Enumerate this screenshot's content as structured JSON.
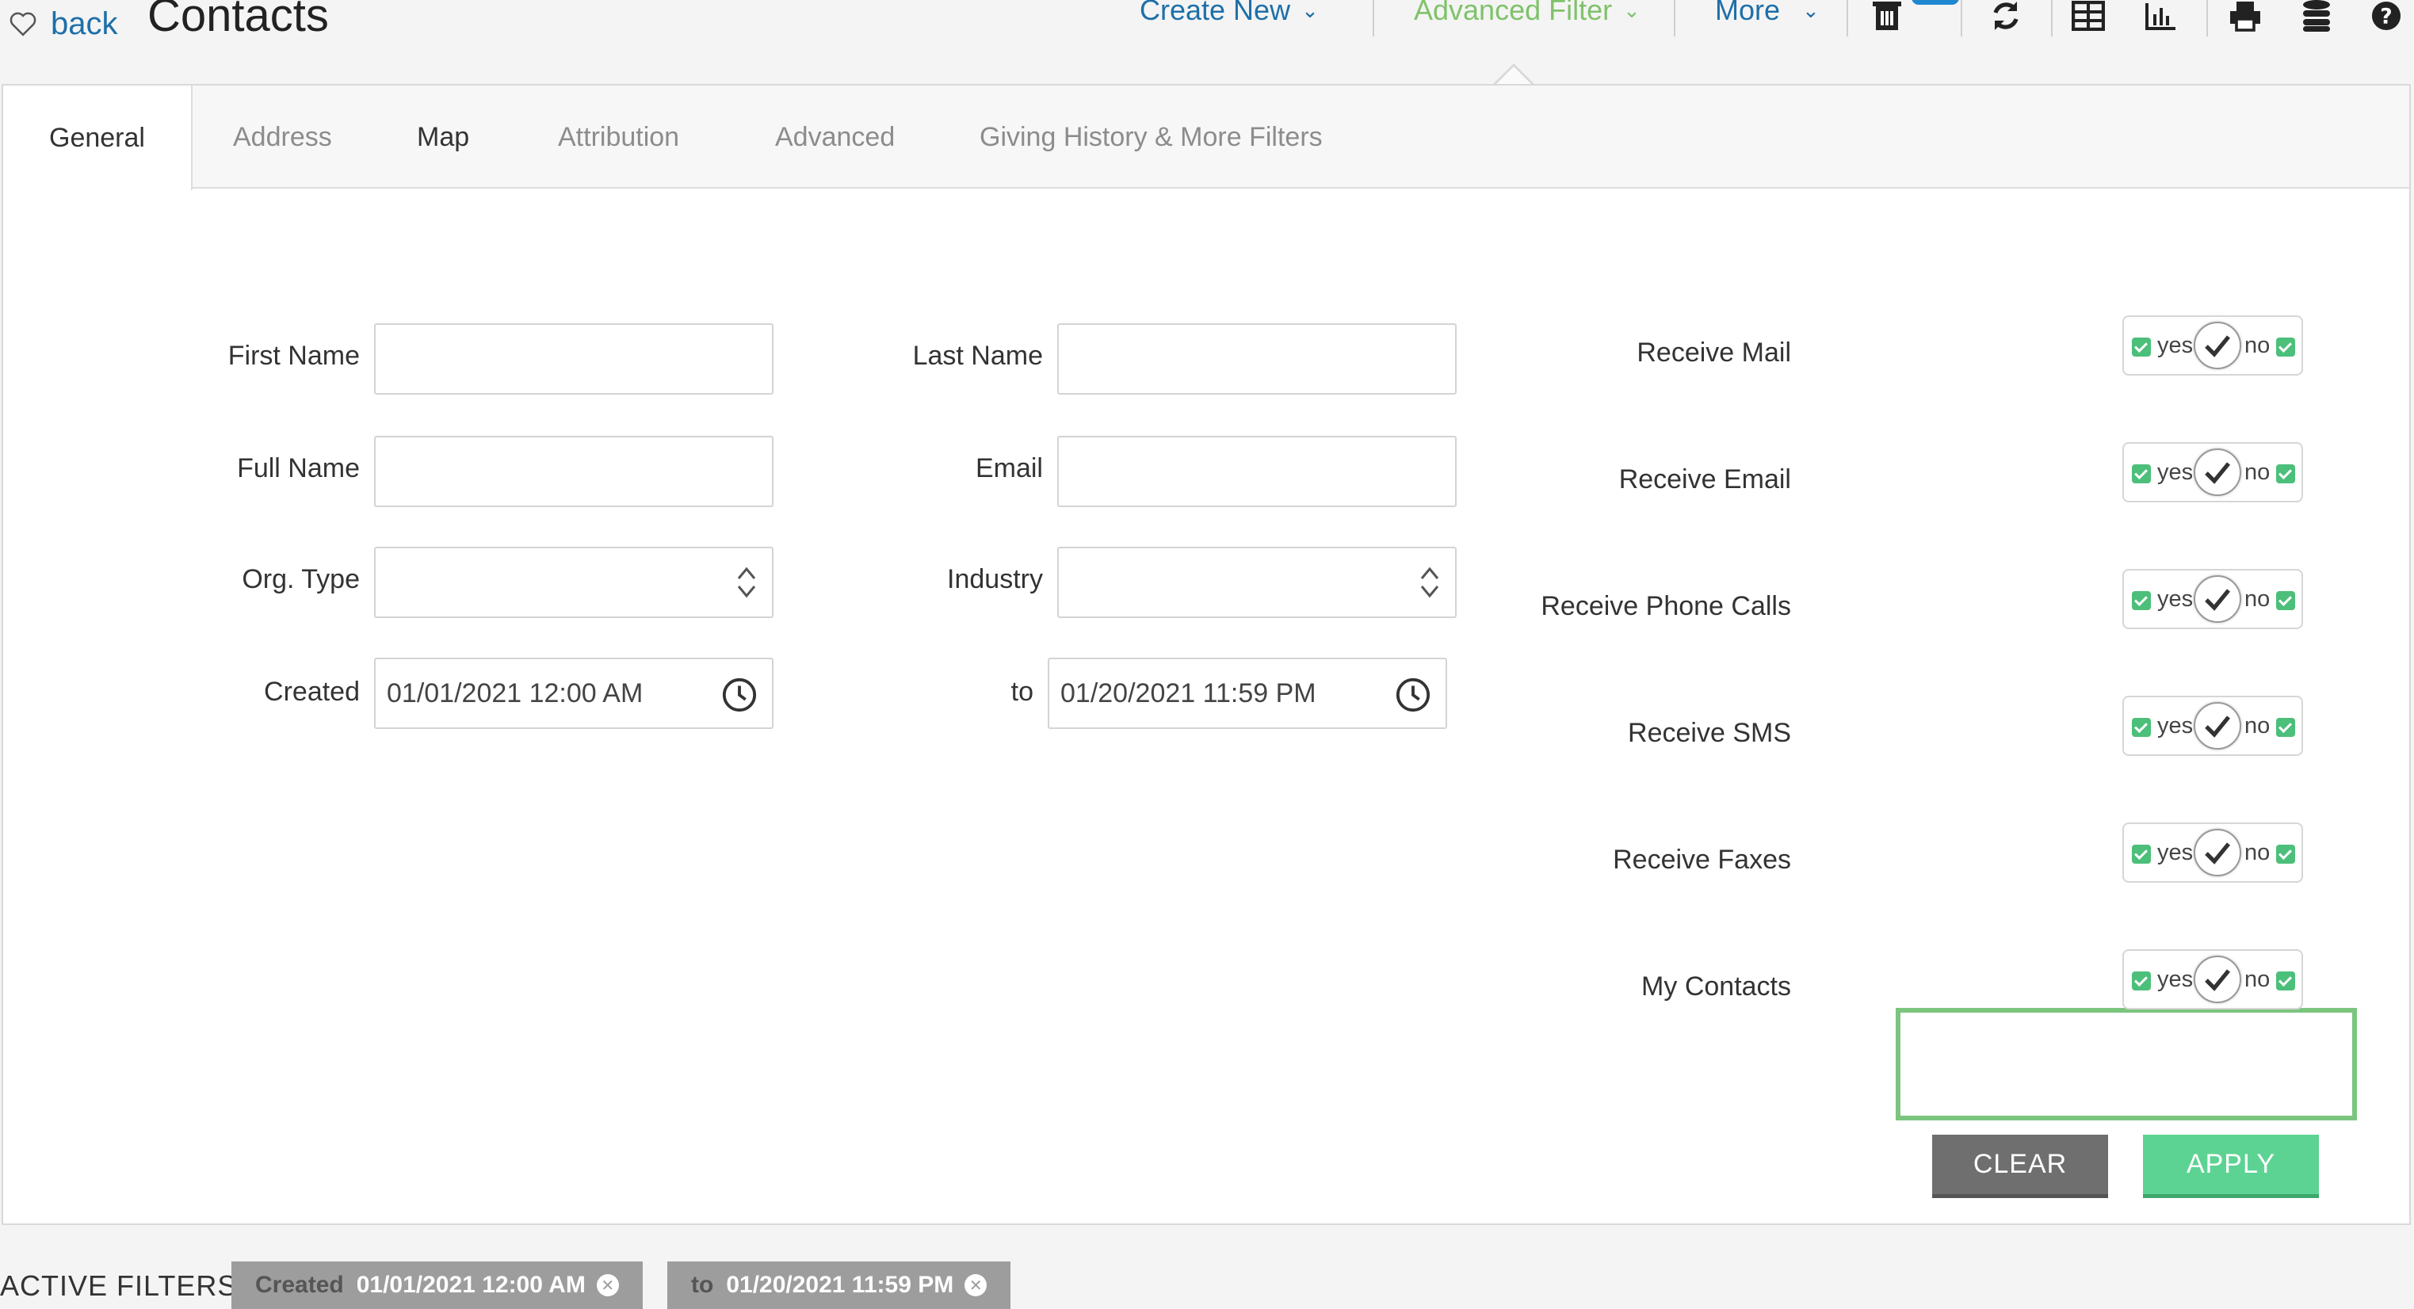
{
  "header": {
    "back_label": "back",
    "title": "Contacts",
    "create_new": "Create New",
    "advanced_filter": "Advanced Filter",
    "more": "More",
    "colors": {
      "link": "#1e6fa8",
      "active_menu": "#7fc26a"
    }
  },
  "tabs": [
    {
      "label": "General"
    },
    {
      "label": "Address"
    },
    {
      "label": "Map"
    },
    {
      "label": "Attribution"
    },
    {
      "label": "Advanced"
    },
    {
      "label": "Giving History & More Filters"
    }
  ],
  "form": {
    "first_name": {
      "label": "First Name",
      "value": ""
    },
    "last_name": {
      "label": "Last Name",
      "value": ""
    },
    "full_name": {
      "label": "Full Name",
      "value": ""
    },
    "email": {
      "label": "Email",
      "value": ""
    },
    "org_type": {
      "label": "Org. Type",
      "value": ""
    },
    "industry": {
      "label": "Industry",
      "value": ""
    },
    "created": {
      "label": "Created",
      "value": "01/01/2021 12:00 AM"
    },
    "to": {
      "label": "to",
      "value": "01/20/2021 11:59 PM"
    }
  },
  "toggles": [
    {
      "label": "Receive Mail",
      "yes": "yes",
      "no": "no"
    },
    {
      "label": "Receive Email",
      "yes": "yes",
      "no": "no"
    },
    {
      "label": "Receive Phone Calls",
      "yes": "yes",
      "no": "no"
    },
    {
      "label": "Receive SMS",
      "yes": "yes",
      "no": "no"
    },
    {
      "label": "Receive Faxes",
      "yes": "yes",
      "no": "no"
    },
    {
      "label": "My Contacts",
      "yes": "yes",
      "no": "no"
    }
  ],
  "buttons": {
    "clear": "CLEAR",
    "apply": "APPLY"
  },
  "active_filters": {
    "label": "ACTIVE FILTERS",
    "chips": [
      {
        "key": "Created",
        "value": "01/01/2021 12:00 AM"
      },
      {
        "key": "to",
        "value": "01/20/2021 11:59 PM"
      }
    ]
  }
}
